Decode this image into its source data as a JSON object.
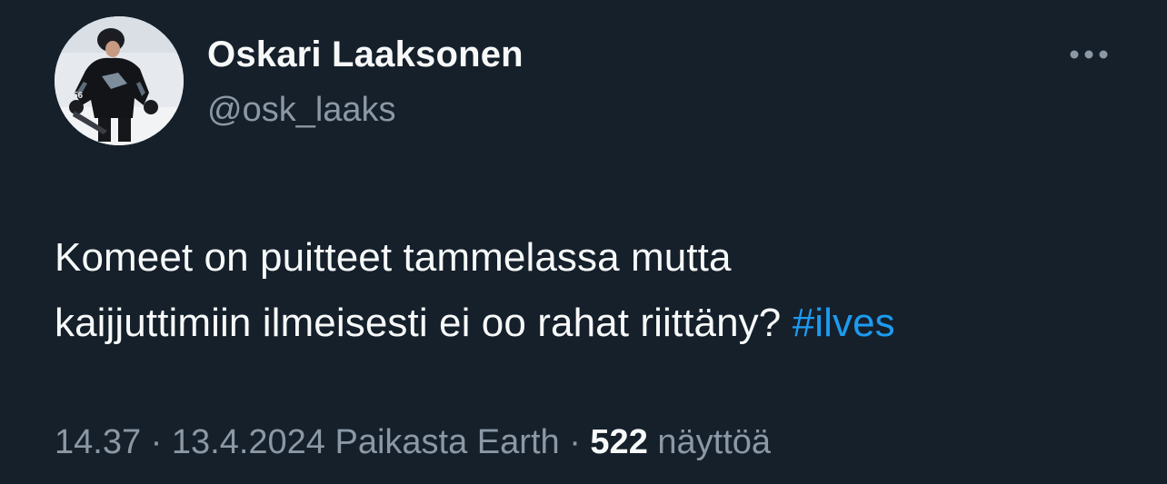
{
  "author": {
    "display_name": "Oskari Laaksonen",
    "handle": "@osk_laaks",
    "avatar_icon": "hockey-player-avatar",
    "jersey_number": "56"
  },
  "actions": {
    "more_icon": "more-horizontal-icon"
  },
  "tweet": {
    "text_line1": "Komeet on puitteet tammelassa mutta",
    "text_line2": "kaijjuttimiin ilmeisesti ei oo rahat riittäny?",
    "hashtag": "#ilves"
  },
  "meta": {
    "time": "14.37",
    "separator1": "·",
    "date": "13.4.2024",
    "location": "Paikasta Earth",
    "separator2": "·",
    "views_count": "522",
    "views_label": "näyttöä"
  },
  "colors": {
    "background": "#15202b",
    "primary_text": "#f7f9f9",
    "secondary_text": "#8b98a5",
    "link": "#1d9bf0"
  }
}
